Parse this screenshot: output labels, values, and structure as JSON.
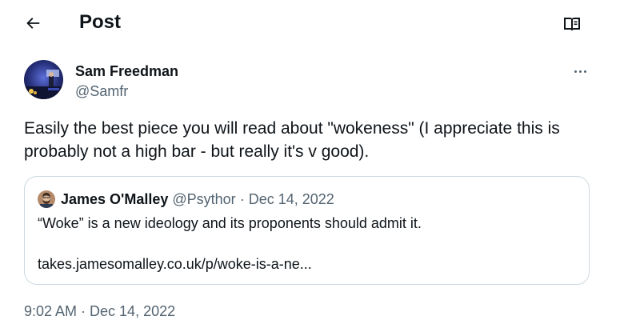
{
  "header": {
    "title": "Post",
    "back_icon": "arrow-left-icon",
    "reader_icon": "open-book-icon"
  },
  "tweet": {
    "author_name": "Sam Freedman",
    "author_handle": "@Samfr",
    "text": "Easily the best piece you will read about \"wokeness\" (I appreciate this is probably not a high bar - but really it's v good).",
    "timestamp": "9:02 AM · Dec 14, 2022",
    "more_icon": "more-horizontal-icon"
  },
  "quote": {
    "author_name": "James O'Malley",
    "author_handle": "@Psythor",
    "separator": "·",
    "date": "Dec 14, 2022",
    "text": "“Woke” is a new ideology and its proponents should admit it.",
    "link": "takes.jamesomalley.co.uk/p/woke-is-a-ne..."
  },
  "colors": {
    "text_primary": "#0f1419",
    "text_secondary": "#536471",
    "border": "#cfd9de"
  }
}
